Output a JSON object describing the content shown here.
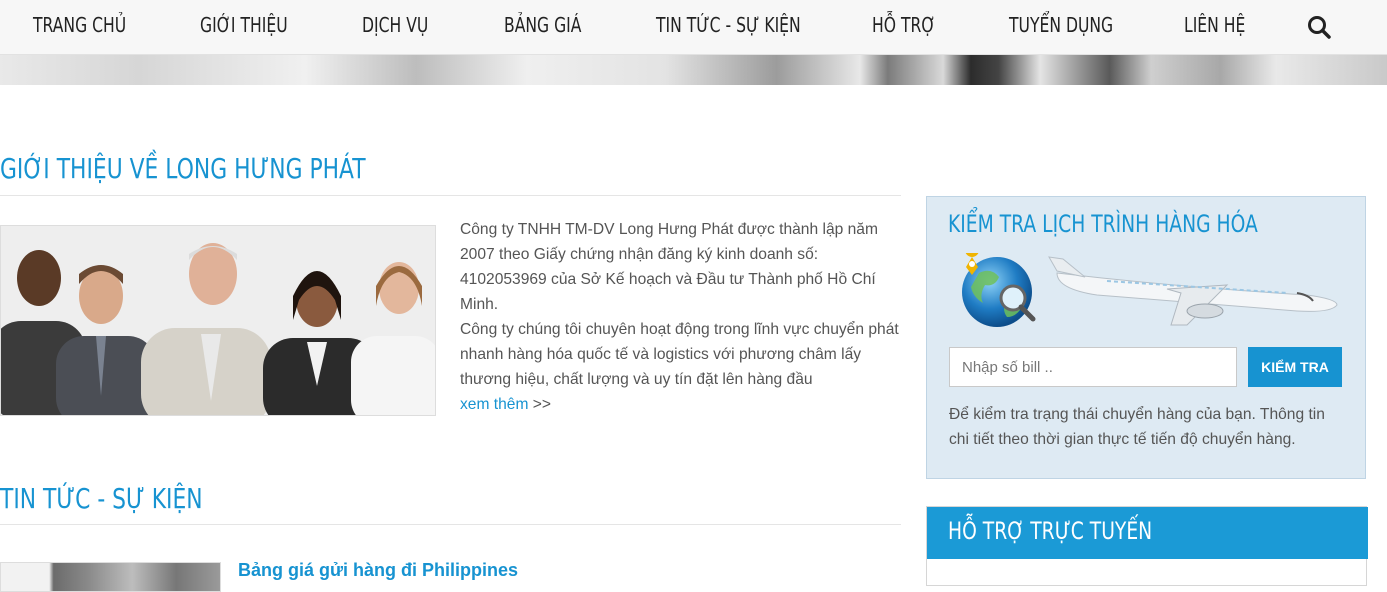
{
  "nav": {
    "items": [
      {
        "label": "TRANG CHỦ"
      },
      {
        "label": "GIỚI THIỆU"
      },
      {
        "label": "DỊCH VỤ"
      },
      {
        "label": "BẢNG GIÁ"
      },
      {
        "label": "TIN TỨC - SỰ KIỆN"
      },
      {
        "label": "HỖ TRỢ"
      },
      {
        "label": "TUYỂN DỤNG"
      },
      {
        "label": "LIÊN HỆ"
      }
    ],
    "search_icon": "search-icon"
  },
  "about": {
    "title": "GIỚI THIỆU VỀ LONG HƯNG PHÁT",
    "paragraph1": "Công ty TNHH TM-DV Long Hưng Phát được thành lập năm 2007 theo Giấy chứng nhận đăng ký kinh doanh số: 4102053969 của Sở Kế hoạch và Đầu tư Thành phố Hồ Chí Minh.",
    "paragraph2": "Công ty chúng tôi chuyên hoạt động trong lĩnh vực chuyển phát nhanh hàng hóa quốc tế và logistics với phương châm lấy thương hiệu, chất lượng và uy tín đặt lên  hàng đầu",
    "read_more": "xem thêm",
    "read_more_suffix": " >>"
  },
  "news": {
    "title": "TIN TỨC - SỰ KIỆN",
    "first_item_title": "Bảng giá gửi hàng đi Philippines"
  },
  "tracking": {
    "title": "KIỂM TRA LỊCH TRÌNH HÀNG HÓA",
    "input_placeholder": "Nhập số bill ..",
    "button_label": "KIỂM TRA",
    "description": "Để kiểm tra trạng thái chuyển hàng của bạn. Thông tin chi tiết theo thời gian thực tế tiến độ chuyển hàng."
  },
  "support": {
    "title": "HỖ TRỢ TRỰC TUYẾN"
  },
  "colors": {
    "accent": "#1793d1",
    "support_header": "#1b9ad6",
    "tracking_bg": "#deeaf3"
  }
}
